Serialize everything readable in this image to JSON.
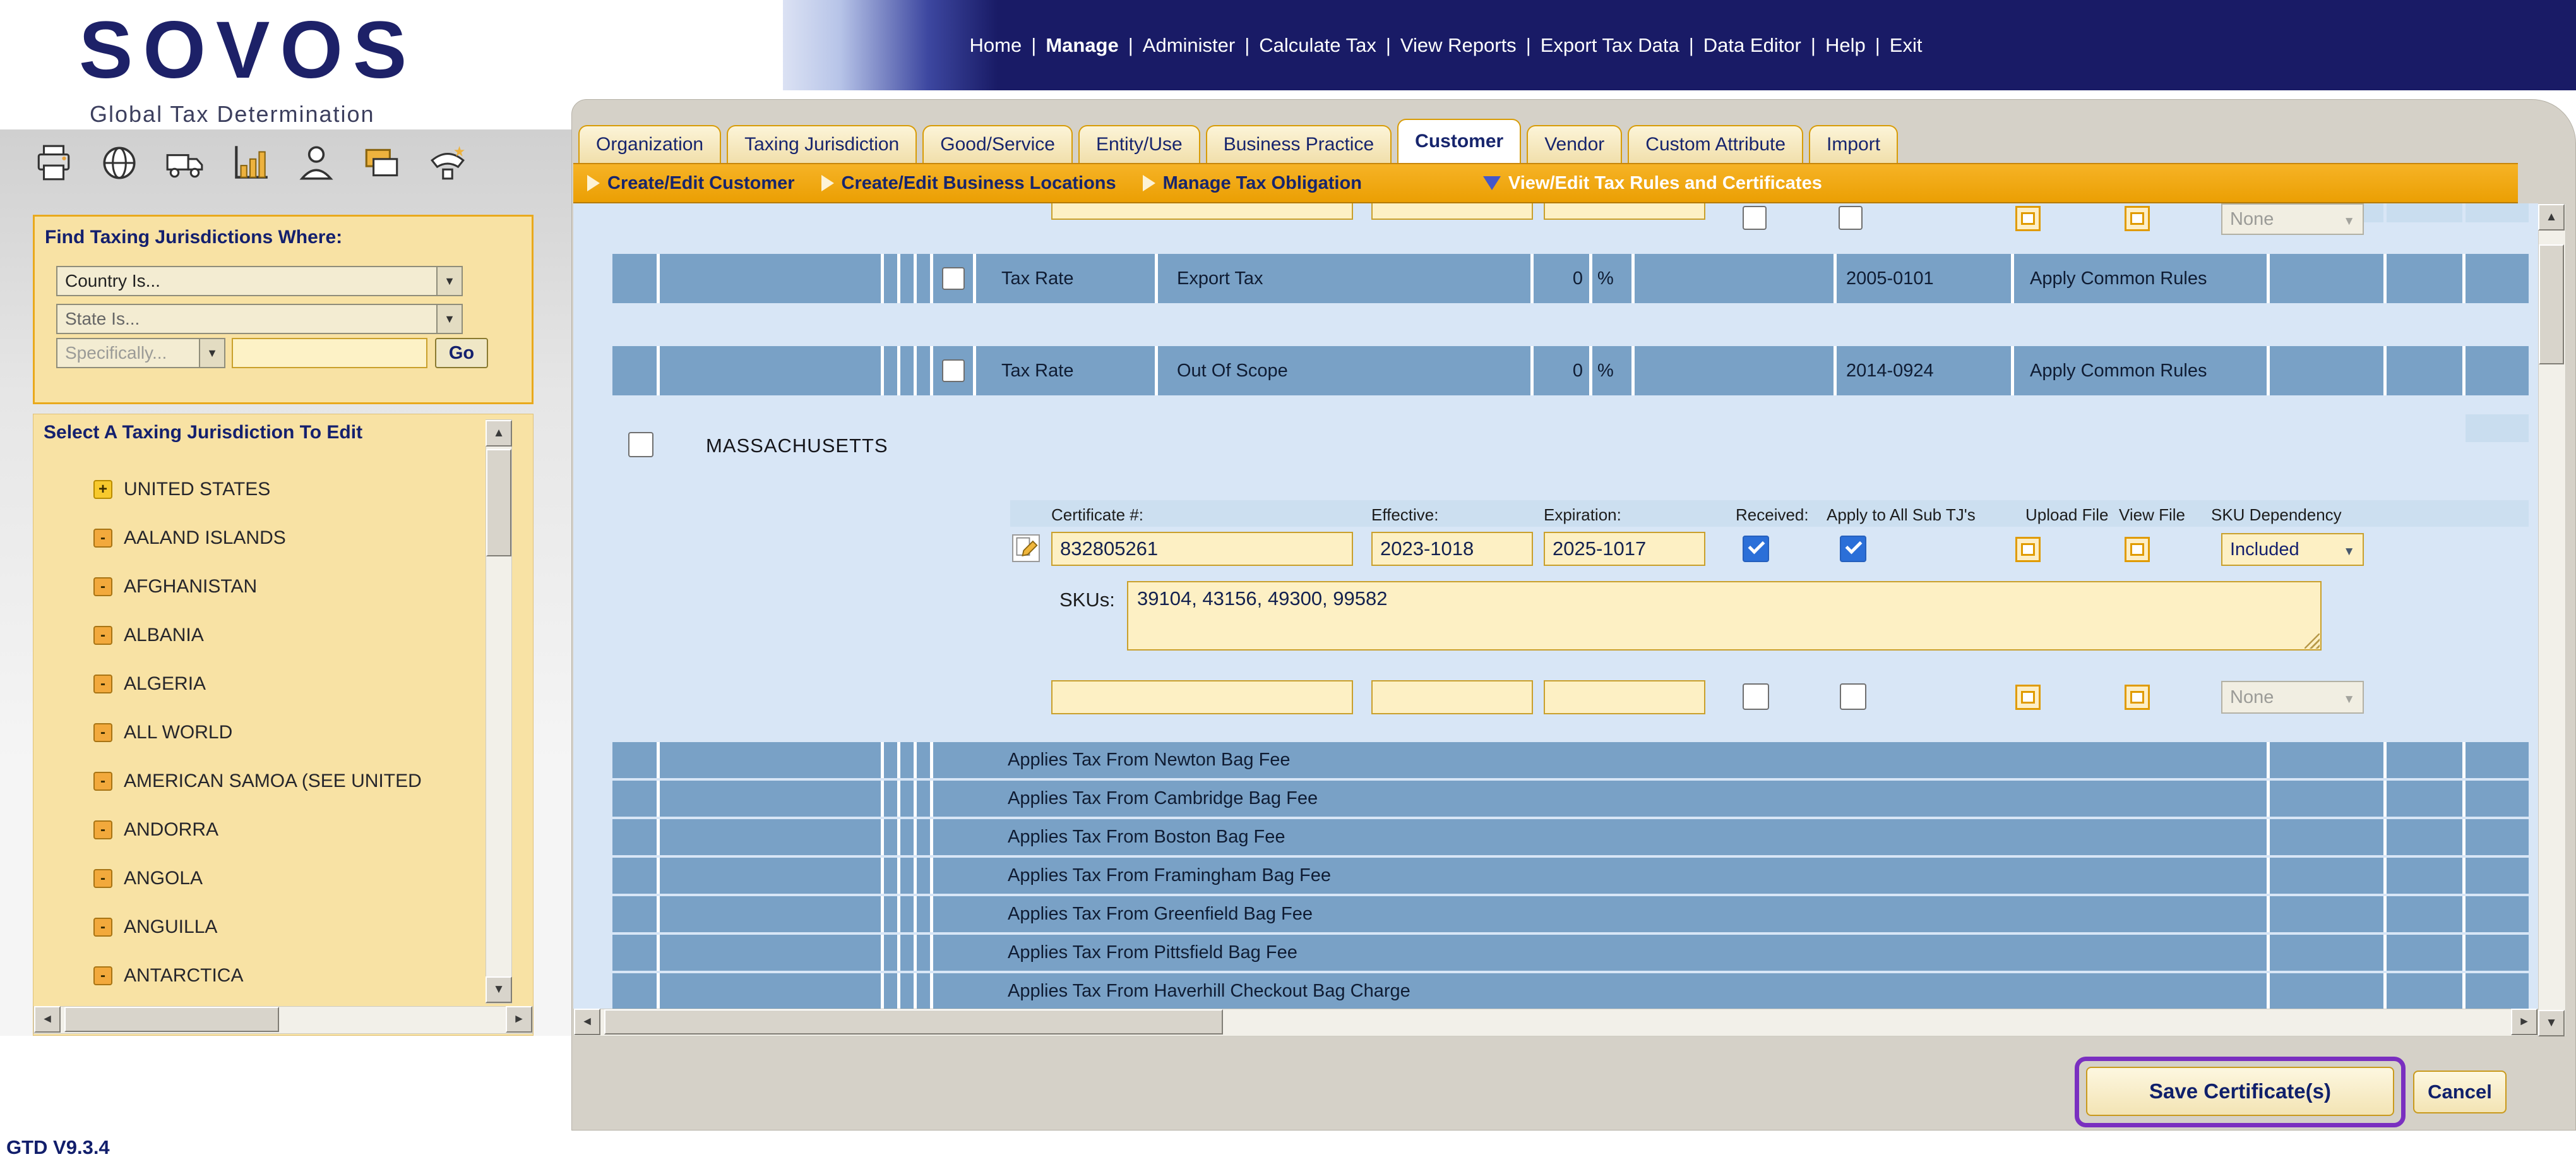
{
  "header": {
    "logo": "SOVOS",
    "tagline": "Global Tax Determination",
    "nav_items": [
      "Home",
      "Manage",
      "Administer",
      "Calculate Tax",
      "View Reports",
      "Export Tax Data",
      "Data Editor",
      "Help",
      "Exit"
    ],
    "nav_bold": "Manage",
    "nav_separator": "|"
  },
  "sidebar": {
    "toolbar_icons": [
      "printer-icon",
      "globe-icon",
      "truck-icon",
      "chart-icon",
      "user-icon",
      "cards-icon",
      "phone-icon"
    ],
    "find_panel": {
      "title": "Find Taxing Jurisdictions Where:",
      "country_value": "Country Is...",
      "state_value": "State Is...",
      "specific_value": "Specifically...",
      "search_value": "",
      "go_label": "Go"
    },
    "select_panel": {
      "title": "Select A Taxing Jurisdiction To Edit",
      "items": [
        {
          "label": "UNITED STATES",
          "symbol": "+",
          "selected": true
        },
        {
          "label": "AALAND ISLANDS",
          "symbol": "-",
          "selected": false
        },
        {
          "label": "AFGHANISTAN",
          "symbol": "-",
          "selected": false
        },
        {
          "label": "ALBANIA",
          "symbol": "-",
          "sel6ected": false
        },
        {
          "label": "ALGERIA",
          "symbol": "-",
          "selected": false
        },
        {
          "label": "ALL WORLD",
          "symbol": "-",
          "selected": false
        },
        {
          "label": "AMERICAN SAMOA (SEE UNITED",
          "symbol": "-",
          "selected": false
        },
        {
          "label": "ANDORRA",
          "symbol": "-",
          "selected": false
        },
        {
          "label": "ANGOLA",
          "symbol": "-",
          "selected": false
        },
        {
          "label": "ANGUILLA",
          "symbol": "-",
          "selected": false
        },
        {
          "label": "ANTARCTICA",
          "symbol": "-",
          "selected": false
        }
      ]
    }
  },
  "tabs": {
    "items": [
      "Organization",
      "Taxing Jurisdiction",
      "Good/Service",
      "Entity/Use",
      "Business Practice",
      "Customer",
      "Vendor",
      "Custom Attribute",
      "Import"
    ],
    "selected": "Customer"
  },
  "breadcrumbs": [
    {
      "label": "Create/Edit Customer",
      "active": false
    },
    {
      "label": "Create/Edit Business Locations",
      "active": false
    },
    {
      "label": "Manage Tax Obligation",
      "active": false
    },
    {
      "label": "View/Edit Tax Rules and Certificates",
      "active": true
    }
  ],
  "content": {
    "tax_rows": [
      {
        "type": "Tax Rate",
        "name": "Export Tax",
        "value": "0",
        "unit": "%",
        "date": "2005-0101",
        "rule": "Apply Common Rules"
      },
      {
        "type": "Tax Rate",
        "name": "Out Of Scope",
        "value": "0",
        "unit": "%",
        "date": "2014-0924",
        "rule": "Apply Common Rules"
      }
    ],
    "jurisdiction": {
      "label": "MASSACHUSETTS"
    },
    "certificate": {
      "headers": {
        "number": "Certificate #:",
        "effective": "Effective:",
        "expiration": "Expiration:",
        "received": "Received:",
        "apply_all": "Apply to All Sub TJ's",
        "upload": "Upload File",
        "view": "View File",
        "sku": "SKU Dependency"
      },
      "row": {
        "number": "832805261",
        "effective": "2023-1018",
        "expiration": "2025-1017",
        "received": true,
        "apply_all": true,
        "sku_dependency": "Included"
      },
      "skus_label": "SKUs:",
      "skus_value": "39104, 43156, 49300, 99582",
      "empty_sku_dependency": "None"
    },
    "applies_rows": [
      "Applies Tax From Newton Bag Fee",
      "Applies Tax From Cambridge Bag Fee",
      "Applies Tax From Boston Bag Fee",
      "Applies Tax From Framingham Bag Fee",
      "Applies Tax From Greenfield Bag Fee",
      "Applies Tax From Pittsfield Bag Fee",
      "Applies Tax From Haverhill Checkout Bag Charge"
    ]
  },
  "footer": {
    "save_label": "Save Certificate(s)",
    "cancel_label": "Cancel",
    "version": "GTD V9.3.4"
  },
  "colors": {
    "accent_orange": "#EFA50A",
    "navy": "#191B66",
    "row_blue": "#79A1C6",
    "panel_tan": "#F8E2A4",
    "input_tan": "#FDF0C4",
    "highlight_purple": "#7A2FC0"
  }
}
